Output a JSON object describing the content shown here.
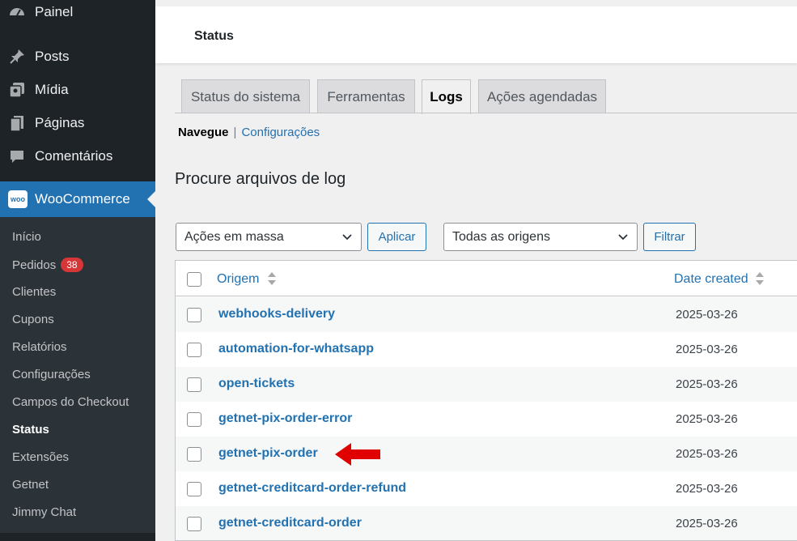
{
  "sidebar": {
    "items": [
      {
        "label": "Painel",
        "icon": "dashboard-icon"
      },
      {
        "label": "Posts",
        "icon": "pin-icon"
      },
      {
        "label": "Mídia",
        "icon": "media-icon"
      },
      {
        "label": "Páginas",
        "icon": "pages-icon"
      },
      {
        "label": "Comentários",
        "icon": "comment-icon"
      }
    ],
    "woocommerce": {
      "label": "WooCommerce",
      "badge": "woo"
    },
    "submenu": [
      {
        "label": "Início"
      },
      {
        "label": "Pedidos",
        "count": "38"
      },
      {
        "label": "Clientes"
      },
      {
        "label": "Cupons"
      },
      {
        "label": "Relatórios"
      },
      {
        "label": "Configurações"
      },
      {
        "label": "Campos do Checkout"
      },
      {
        "label": "Status"
      },
      {
        "label": "Extensões"
      },
      {
        "label": "Getnet"
      },
      {
        "label": "Jimmy Chat"
      }
    ]
  },
  "header": {
    "title": "Status"
  },
  "tabs": [
    {
      "label": "Status do sistema"
    },
    {
      "label": "Ferramentas"
    },
    {
      "label": "Logs"
    },
    {
      "label": "Ações agendadas"
    }
  ],
  "subnav": {
    "current": "Navegue",
    "separator": "|",
    "link": "Configurações"
  },
  "section_title": "Procure arquivos de log",
  "controls": {
    "bulk_select": "Ações em massa",
    "apply_label": "Aplicar",
    "origin_select": "Todas as origens",
    "filter_label": "Filtrar"
  },
  "table": {
    "columns": {
      "origin": "Origem",
      "date": "Date created"
    },
    "rows": [
      {
        "origin": "webhooks-delivery",
        "date": "2025-03-26"
      },
      {
        "origin": "automation-for-whatsapp",
        "date": "2025-03-26"
      },
      {
        "origin": "open-tickets",
        "date": "2025-03-26"
      },
      {
        "origin": "getnet-pix-order-error",
        "date": "2025-03-26"
      },
      {
        "origin": "getnet-pix-order",
        "date": "2025-03-26"
      },
      {
        "origin": "getnet-creditcard-order-refund",
        "date": "2025-03-26"
      },
      {
        "origin": "getnet-creditcard-order",
        "date": "2025-03-26"
      }
    ]
  },
  "colors": {
    "accent": "#2271b1",
    "sidebar_bg": "#1d2327",
    "badge": "#d63638",
    "arrow": "#e00000"
  }
}
